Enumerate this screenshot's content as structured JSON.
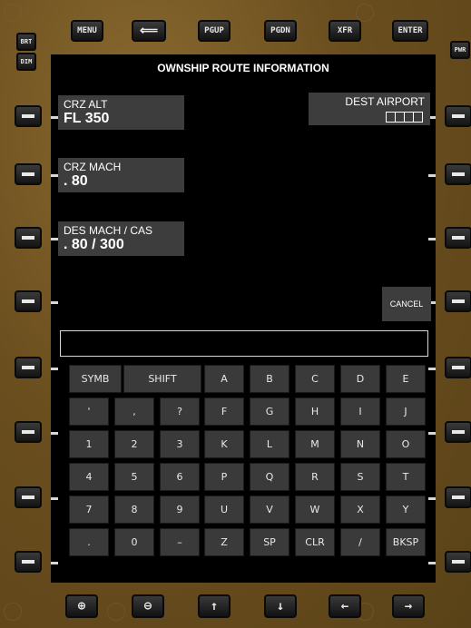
{
  "bezel": {
    "left_small": {
      "brt": "BRT",
      "dim": "DIM"
    },
    "right_small": {
      "pwr": "PWR"
    },
    "top_keys": [
      "MENU",
      "⟸",
      "PGUP",
      "PGDN",
      "XFR",
      "ENTER"
    ],
    "bottom_keys": [
      "⊕",
      "⊖",
      "↑",
      "↓",
      "←",
      "→"
    ]
  },
  "screen": {
    "title": "OWNSHIP ROUTE INFORMATION",
    "crz_alt": {
      "label": "CRZ ALT",
      "value": "FL 350"
    },
    "crz_mach": {
      "label": "CRZ MACH",
      "value": ". 80"
    },
    "des_mach_cas": {
      "label": "DES MACH / CAS",
      "value": ". 80 / 300"
    },
    "dest_airport": {
      "label": "DEST AIRPORT"
    },
    "cancel_label": "CANCEL",
    "scratchpad": ""
  },
  "keyboard": {
    "row0": [
      "SYMB",
      "SHIFT",
      "A",
      "B",
      "C",
      "D",
      "E"
    ],
    "row1": [
      "'",
      ",",
      "?",
      "F",
      "G",
      "H",
      "I",
      "J"
    ],
    "row2": [
      "1",
      "2",
      "3",
      "K",
      "L",
      "M",
      "N",
      "O"
    ],
    "row3": [
      "4",
      "5",
      "6",
      "P",
      "Q",
      "R",
      "S",
      "T"
    ],
    "row4": [
      "7",
      "8",
      "9",
      "U",
      "V",
      "W",
      "X",
      "Y"
    ],
    "row5": [
      ".",
      "0",
      "–",
      "Z",
      "SP",
      "CLR",
      "/",
      "BKSP"
    ]
  }
}
